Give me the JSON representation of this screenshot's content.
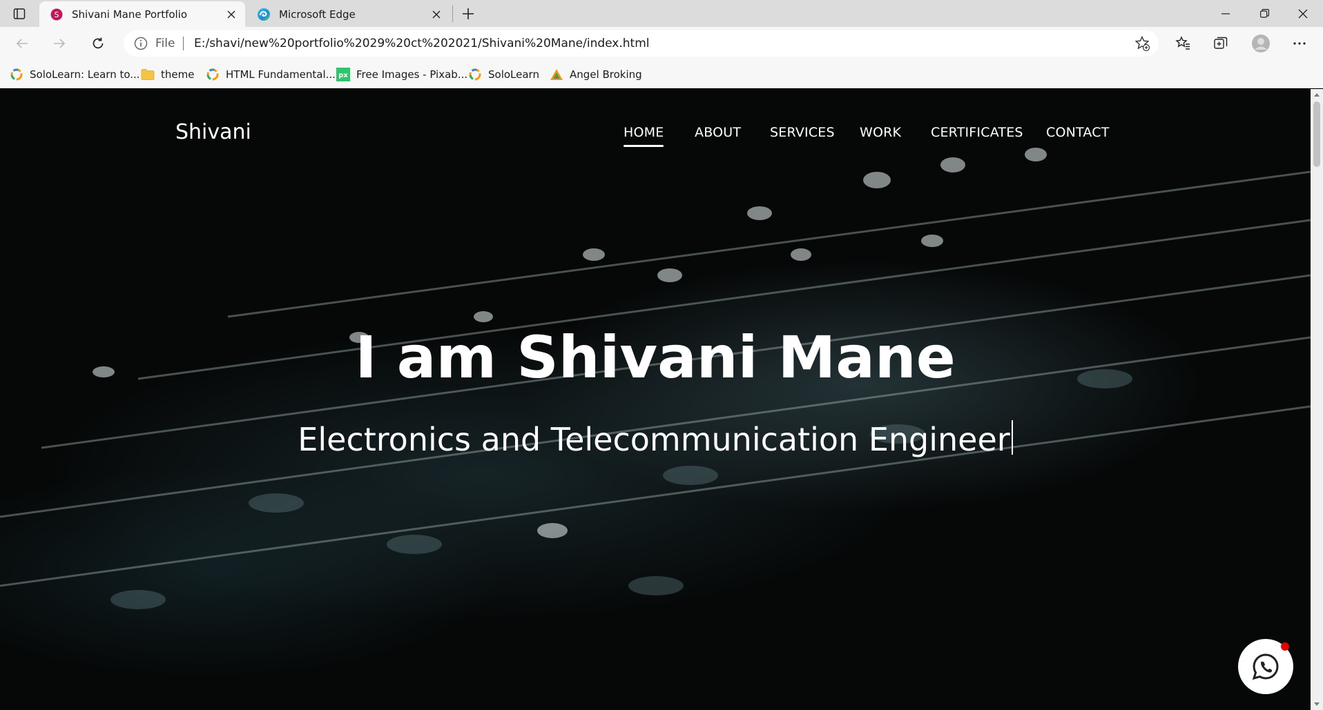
{
  "browser": {
    "tabs": [
      {
        "title": "Shivani Mane Portfolio",
        "favicon_letter": "S",
        "active": true
      },
      {
        "title": "Microsoft Edge",
        "active": false
      }
    ],
    "address_bar": {
      "scheme_label": "File",
      "url": "E:/shavi/new%20portfolio%2029%20ct%202021/Shivani%20Mane/index.html"
    },
    "bookmarks": [
      {
        "label": "SoloLearn: Learn to...",
        "icon": "sololearn-icon"
      },
      {
        "label": "theme",
        "icon": "folder-icon"
      },
      {
        "label": "HTML Fundamental...",
        "icon": "sololearn-icon"
      },
      {
        "label": "Free Images - Pixab...",
        "icon": "pixabay-icon",
        "icon_text": "px"
      },
      {
        "label": "SoloLearn",
        "icon": "sololearn-icon"
      },
      {
        "label": "Angel Broking",
        "icon": "angel-broking-icon"
      }
    ]
  },
  "site": {
    "brand": "Shivani",
    "nav": [
      {
        "label": "HOME",
        "active": true
      },
      {
        "label": "ABOUT"
      },
      {
        "label": "SERVICES"
      },
      {
        "label": "WORK"
      },
      {
        "label": "CERTIFICATES"
      },
      {
        "label": "CONTACT"
      }
    ],
    "hero": {
      "title": "I am Shivani Mane",
      "subtitle": "Electronics and Telecommunication Engineer"
    },
    "whatsapp_icon": "whatsapp-icon"
  },
  "colors": {
    "tab_favicon": "#c2185b",
    "whatsapp_dot": "#e60000",
    "page_background": "#060808"
  }
}
